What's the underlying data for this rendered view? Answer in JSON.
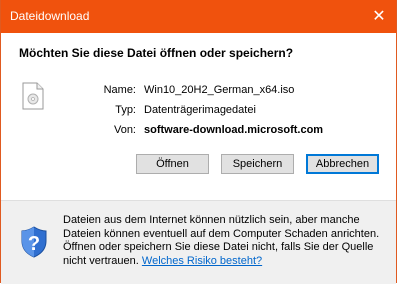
{
  "window": {
    "title": "Dateidownload",
    "close_glyph": "✕"
  },
  "dialog": {
    "question": "Möchten Sie diese Datei öffnen oder speichern?",
    "fields": {
      "name_label": "Name:",
      "name_value": "Win10_20H2_German_x64.iso",
      "type_label": "Typ:",
      "type_value": "Datenträgerimagedatei",
      "from_label": "Von:",
      "from_value": "software-download.microsoft.com"
    },
    "buttons": {
      "open": "Öffnen",
      "save": "Speichern",
      "cancel": "Abbrechen"
    }
  },
  "footer": {
    "info_text": "Dateien aus dem Internet können nützlich sein, aber manche Dateien können eventuell auf dem Computer Schaden anrichten. Öffnen oder speichern Sie diese Datei nicht, falls Sie der Quelle nicht vertrauen.",
    "link_text": "Welches Risiko besteht?"
  },
  "icons": {
    "file": "file-icon",
    "shield": "security-shield-icon"
  },
  "colors": {
    "titlebar": "#f0520d",
    "link": "#0066cc",
    "default_button_border": "#0078d7"
  }
}
